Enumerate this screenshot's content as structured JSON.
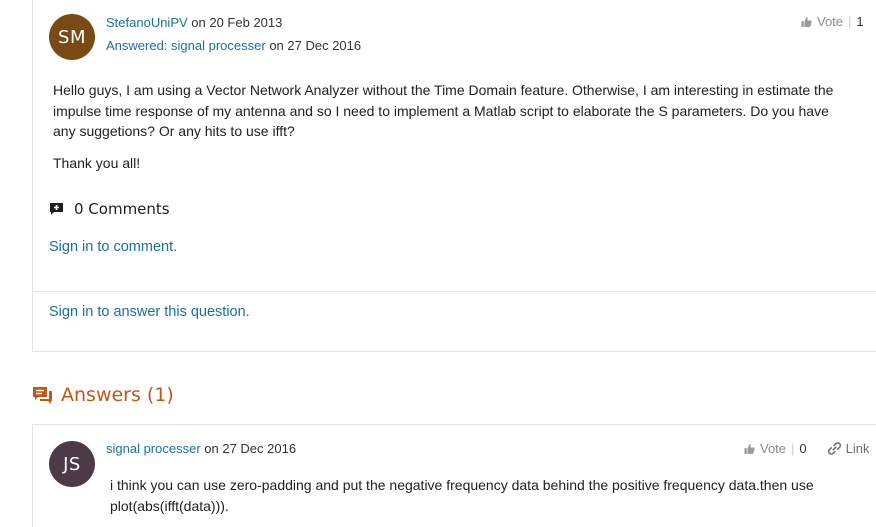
{
  "question": {
    "avatar_initials": "SM",
    "avatar_color": "#7a4a14",
    "author": "StefanoUniPV",
    "posted_prefix": " on ",
    "posted_date": "20 Feb 2013",
    "answered_label": "Answered: signal processer",
    "answered_prefix": " on ",
    "answered_date": "27 Dec 2016",
    "vote_label": "Vote",
    "vote_count": "1",
    "body": [
      "Hello guys, I am using a Vector Network Analyzer without the Time Domain feature. Otherwise, I am interesting in estimate the impulse time response of my antenna and so I need to implement a Matlab script to elaborate the S parameters. Do you have any suggetions? Or any hits to use ifft?",
      "Thank you all!"
    ],
    "comments_label": "0 Comments",
    "sign_in_comment": "Sign in to comment.",
    "sign_in_answer": "Sign in to answer this question."
  },
  "answers_heading": "Answers (1)",
  "answer": {
    "avatar_initials": "JS",
    "avatar_color": "#4d3a47",
    "author": "signal processer",
    "posted_prefix": " on ",
    "posted_date": "27 Dec 2016",
    "vote_label": "Vote",
    "vote_count": "0",
    "link_label": "Link",
    "body": "i think you can use zero-padding and put the negative frequency data behind the positive frequency data.then use plot(abs(ifft(data)))."
  },
  "colors": {
    "link": "#1a6fa0",
    "accent": "#c0561a",
    "muted": "#8a8a8a"
  },
  "icons": {
    "vote": "thumbs-up-icon",
    "comments": "comment-plus-icon",
    "answers": "answers-bubble-icon",
    "link": "chain-link-icon"
  }
}
